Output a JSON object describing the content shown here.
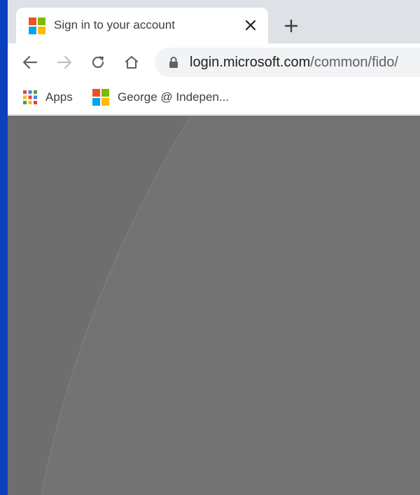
{
  "tab": {
    "title": "Sign in to your account",
    "favicon": "microsoft-logo-icon"
  },
  "toolbar": {
    "back_icon": "arrow-left-icon",
    "forward_icon": "arrow-right-icon",
    "reload_icon": "reload-icon",
    "home_icon": "home-icon"
  },
  "address_bar": {
    "host": "login.microsoft.com",
    "path": "/common/fido/"
  },
  "bookmarks": [
    {
      "label": "Apps",
      "icon": "apps-grid-icon"
    },
    {
      "label": "George @ Indepen...",
      "icon": "microsoft-logo-icon"
    }
  ],
  "colors": {
    "accent_strip": "#0a3fbe",
    "page_background": "#737373",
    "ms_red": "#f25022",
    "ms_green": "#7fba00",
    "ms_blue": "#00a4ef",
    "ms_yellow": "#ffb900"
  }
}
